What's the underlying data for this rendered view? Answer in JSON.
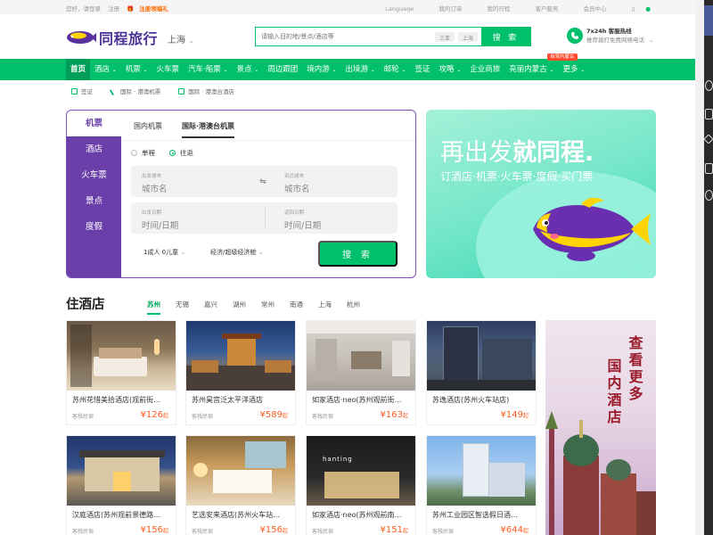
{
  "topbar": {
    "greeting": "您好，请登录",
    "register": "注册",
    "gift": "注册领福礼",
    "language": "Language",
    "my_orders": "我的订单",
    "my_trips": "我的行程",
    "customer_service": "客户服务",
    "member_center": "会员中心"
  },
  "header": {
    "logo_text": "同程旅行",
    "city": "上海",
    "search_placeholder": "请输入目的地/景点/酒店等",
    "search_chips": [
      "三亚",
      "上海"
    ],
    "search_button": "搜 索",
    "hotline_title": "7x24h 客服热线",
    "hotline_sub": "推荐拨打免费网络电话"
  },
  "nav": {
    "items": [
      "首页",
      "酒店",
      "机票",
      "火车票",
      "汽车·船票",
      "景点",
      "周边跟团",
      "境内游",
      "出境游",
      "邮轮",
      "签证",
      "攻略",
      "企业商旅",
      "亮丽内蒙古",
      "更多"
    ],
    "promo_tag": "自驾内蒙古"
  },
  "sublinks": [
    "签证",
    "国际 · 港澳机票",
    "国际 · 港澳台酒店"
  ],
  "booking": {
    "side_tabs": [
      "机票",
      "酒店",
      "火车票",
      "景点",
      "度假"
    ],
    "flight_tabs": [
      "国内机票",
      "国际·港澳台机票"
    ],
    "trip_types": [
      "单程",
      "往返"
    ],
    "from_label": "出发城市",
    "from_value": "城市名",
    "to_label": "到达城市",
    "to_value": "城市名",
    "depart_label": "出发日期",
    "depart_value": "时间/日期",
    "return_label": "返回日期",
    "return_value": "时间/日期",
    "passengers": "1成人 0儿童",
    "cabin": "经济/超级经济舱",
    "search_button": "搜 索"
  },
  "banner": {
    "headline_a": "再出发",
    "headline_b": "就同程.",
    "subline": "订酒店·机票·火车票·度假·买门票"
  },
  "hotels": {
    "title": "住酒店",
    "cities": [
      "苏州",
      "无锡",
      "嘉兴",
      "湖州",
      "常州",
      "南通",
      "上海",
      "杭州"
    ],
    "cards": [
      {
        "name": "苏州花惜美拾酒店(观前街…",
        "tag": "客栈民宿",
        "price": "¥126",
        "unit": "起"
      },
      {
        "name": "苏州昊宫泛太平洋酒店",
        "tag": "客栈民宿",
        "price": "¥589",
        "unit": "起"
      },
      {
        "name": "如家酒店·neo(苏州观前街…",
        "tag": "客栈民宿",
        "price": "¥163",
        "unit": "起"
      },
      {
        "name": "苏逸酒店(苏州火车站店)",
        "tag": "",
        "price": "¥149",
        "unit": "起"
      },
      {
        "name": "汉庭酒店(苏州观前景德路…",
        "tag": "客栈民宿",
        "price": "¥156",
        "unit": "起"
      },
      {
        "name": "艺选安来酒店(苏州火车站…",
        "tag": "客栈民宿",
        "price": "¥156",
        "unit": "起"
      },
      {
        "name": "如家酒店·neo(苏州观前南…",
        "tag": "客栈民宿",
        "price": "¥151",
        "unit": "起"
      },
      {
        "name": "苏州工业园区智选假日酒…",
        "tag": "客栈民宿",
        "price": "¥644",
        "unit": "起"
      }
    ],
    "promo_lines": [
      "查看更多",
      "国内酒店"
    ],
    "hotel_sign": "hanting"
  },
  "colors": {
    "brand_green": "#00c06b",
    "brand_purple": "#6a3fa9",
    "price_orange": "#ff5a1f"
  }
}
